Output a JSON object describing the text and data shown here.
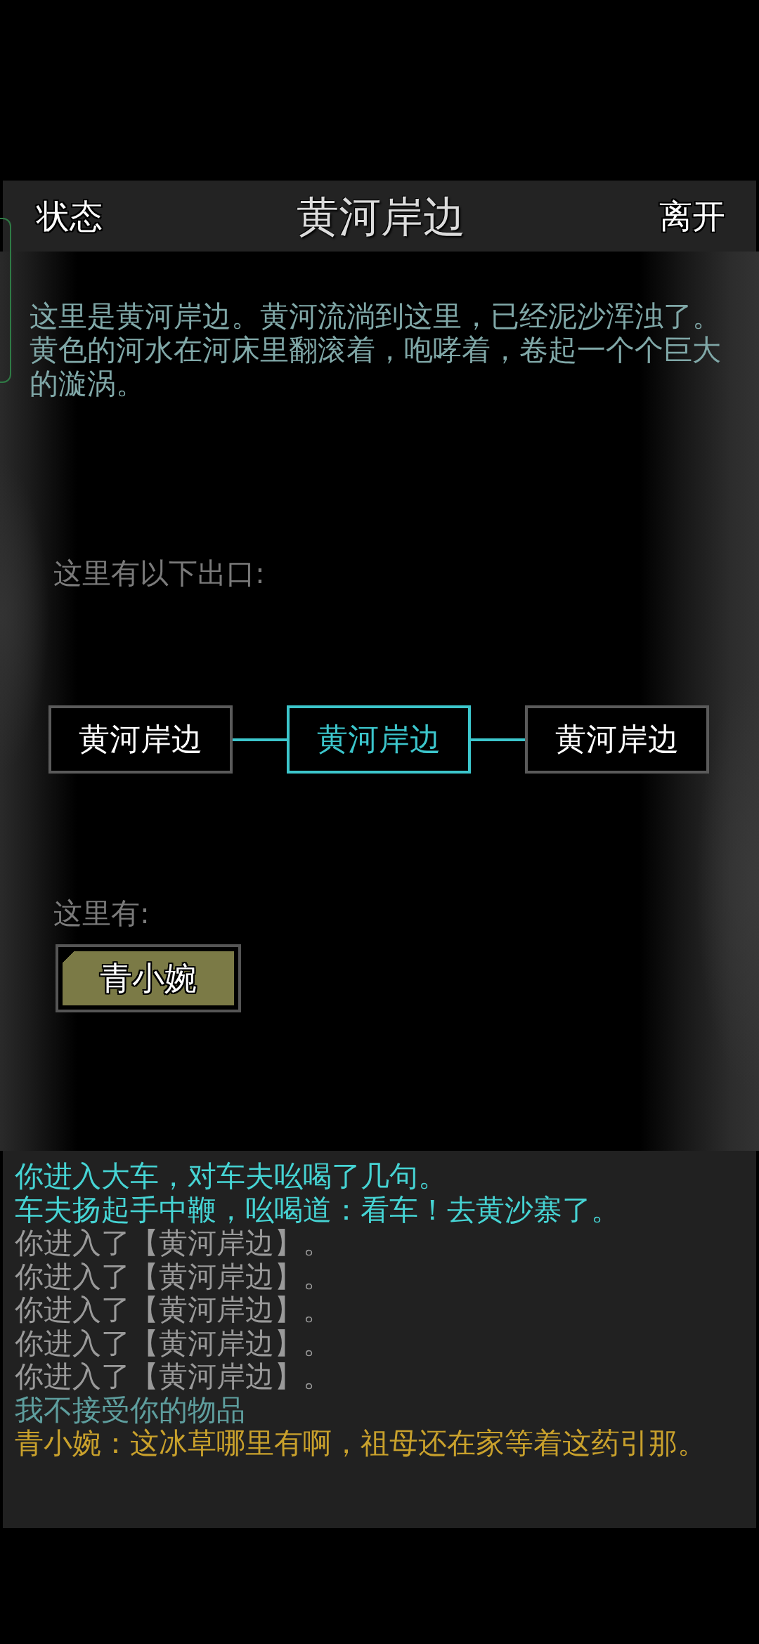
{
  "header": {
    "left_button": "状态",
    "title": "黄河岸边",
    "right_button": "离开"
  },
  "description": "这里是黄河岸边。黄河流淌到这里，已经泥沙浑浊了。黄色的河水在河床里翻滚着，咆哮着，卷起一个个巨大的漩涡。",
  "exits_label": "这里有以下出口:",
  "exits": [
    {
      "label": "黄河岸边",
      "selected": false
    },
    {
      "label": "黄河岸边",
      "selected": true
    },
    {
      "label": "黄河岸边",
      "selected": false
    }
  ],
  "here_label": "这里有:",
  "npcs": [
    {
      "name": "青小婉"
    }
  ],
  "log": [
    {
      "text": "你进入大车，对车夫吆喝了几句。",
      "color": "#46d4d4"
    },
    {
      "text": "车夫扬起手中鞭，吆喝道：看车！去黄沙寨了。",
      "color": "#46d4d4"
    },
    {
      "text": "你进入了【黄河岸边】。",
      "color": "#9a9a9a"
    },
    {
      "text": "你进入了【黄河岸边】。",
      "color": "#9a9a9a"
    },
    {
      "text": "你进入了【黄河岸边】。",
      "color": "#9a9a9a"
    },
    {
      "text": "你进入了【黄河岸边】。",
      "color": "#9a9a9a"
    },
    {
      "text": "你进入了【黄河岸边】。",
      "color": "#9a9a9a"
    },
    {
      "text": "我不接受你的物品",
      "color": "#5e9e9e"
    },
    {
      "text": "青小婉：这冰草哪里有啊，祖母还在家等着这药引那。",
      "color": "#c9a12c"
    }
  ]
}
